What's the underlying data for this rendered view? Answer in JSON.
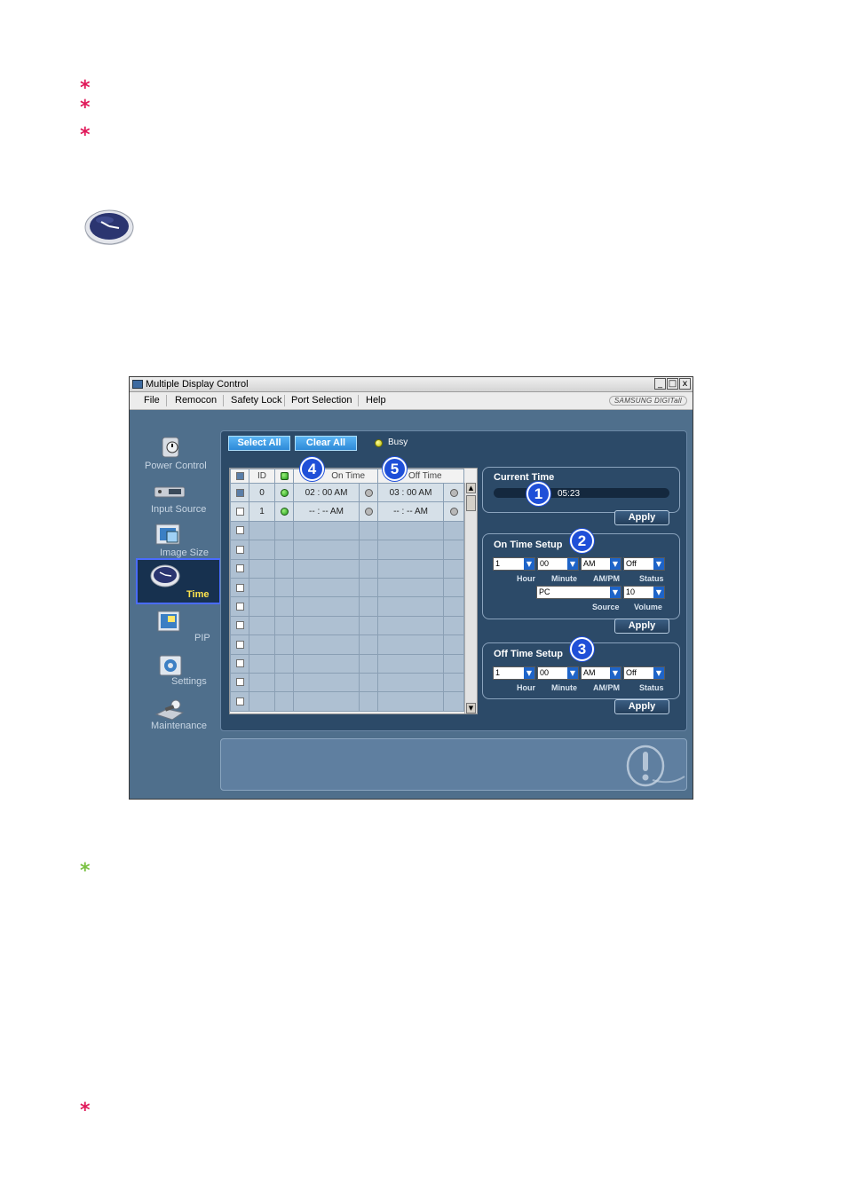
{
  "window": {
    "title": "Multiple Display Control",
    "minimize": "_",
    "maximize": "□",
    "close": "x",
    "brand": "SAMSUNG DIGITall"
  },
  "menu": [
    "File",
    "Remocon",
    "Safety Lock",
    "Port Selection",
    "Help"
  ],
  "nav": [
    {
      "label": "Power Control",
      "icon": "power-control-icon"
    },
    {
      "label": "Input Source",
      "icon": "input-source-icon"
    },
    {
      "label": "Image Size",
      "icon": "image-size-icon"
    },
    {
      "label": "Time",
      "icon": "clock-icon",
      "active": true
    },
    {
      "label": "PIP",
      "icon": "pip-icon"
    },
    {
      "label": "Settings",
      "icon": "settings-icon"
    },
    {
      "label": "Maintenance",
      "icon": "maintenance-icon"
    }
  ],
  "toolbar": {
    "select_all": "Select All",
    "clear_all": "Clear All",
    "busy": "Busy"
  },
  "grid": {
    "headers": [
      "ID",
      "On Time",
      "Off Time"
    ],
    "rows": [
      {
        "id": "0",
        "on_time": "02 : 00 AM",
        "off_time": "03 : 00 AM",
        "checked": true
      },
      {
        "id": "1",
        "on_time": "-- : -- AM",
        "off_time": "-- : -- AM",
        "checked": false
      }
    ],
    "empty_rows": 10
  },
  "current_time": {
    "title": "Current Time",
    "value": "05:23",
    "apply": "Apply"
  },
  "on_time_setup": {
    "title": "On Time Setup",
    "hour": "1",
    "minute": "00",
    "ampm": "AM",
    "status": "Off",
    "source": "PC",
    "volume": "10",
    "labels": {
      "hour": "Hour",
      "minute": "Minute",
      "ampm": "AM/PM",
      "status": "Status",
      "source": "Source",
      "volume": "Volume"
    },
    "apply": "Apply"
  },
  "off_time_setup": {
    "title": "Off Time Setup",
    "hour": "1",
    "minute": "00",
    "ampm": "AM",
    "status": "Off",
    "labels": {
      "hour": "Hour",
      "minute": "Minute",
      "ampm": "AM/PM",
      "status": "Status"
    },
    "apply": "Apply"
  },
  "badges": [
    "1",
    "2",
    "3",
    "4",
    "5"
  ],
  "colors": {
    "star_pink": "#e0195a",
    "star_green": "#7ac142",
    "badge": "#1f4fd8",
    "active_nav": "#4a6cff",
    "active_label": "#ffe44d"
  }
}
